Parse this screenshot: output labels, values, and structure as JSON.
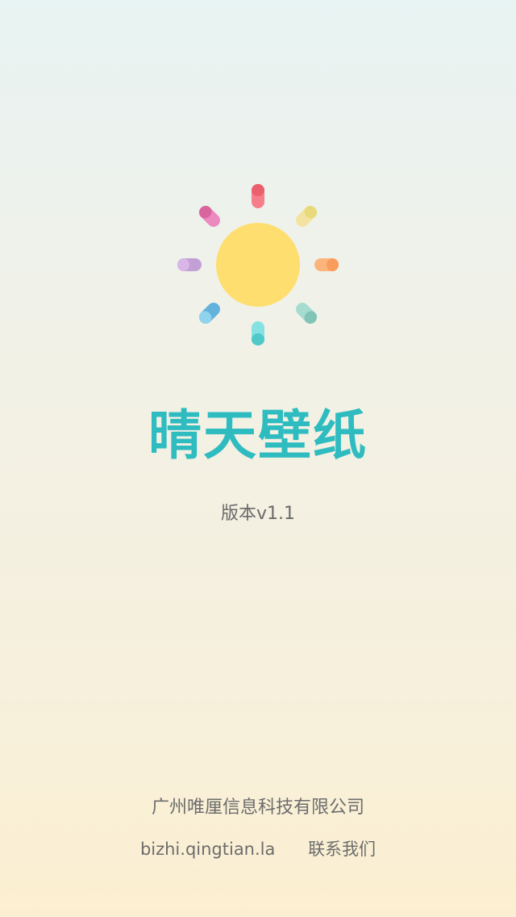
{
  "app": {
    "title": "晴天壁纸",
    "version": "版本v1.1"
  },
  "footer": {
    "company": "广州唯厘信息科技有限公司",
    "website": "bizhi.qingtian.la",
    "contact": "联系我们"
  },
  "logo": {
    "sun_color": "#ffde70",
    "ray_colors": [
      "#f06a79",
      "#eedf8e",
      "#fbab6e",
      "#8ccfc0",
      "#66d6d6",
      "#71c2e0",
      "#c7a3d8",
      "#e27cb3"
    ]
  }
}
